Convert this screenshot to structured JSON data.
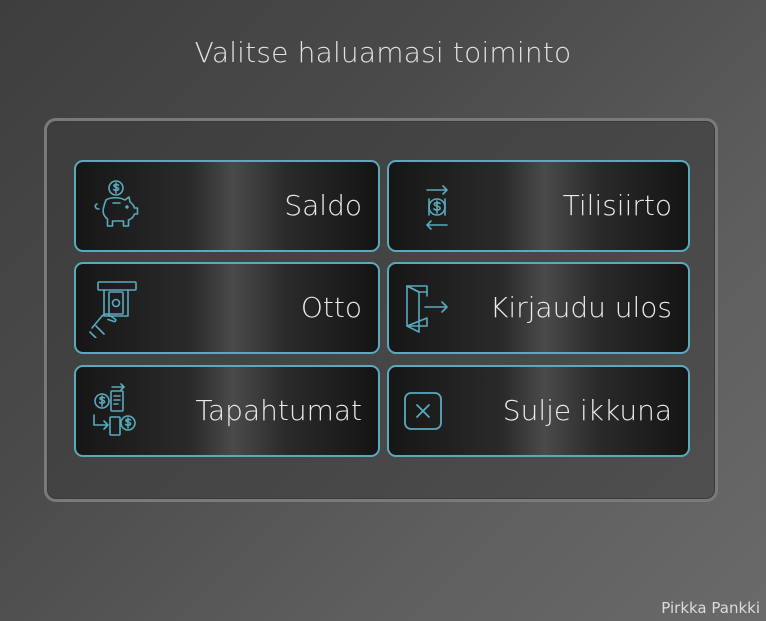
{
  "header": {
    "title": "Valitse haluamasi toiminto"
  },
  "menu": {
    "buttons": [
      {
        "label": "Saldo",
        "icon": "piggy-bank-dollar-icon"
      },
      {
        "label": "Tilisiirto",
        "icon": "transfer-dollar-icon"
      },
      {
        "label": "Otto",
        "icon": "atm-cash-withdraw-icon"
      },
      {
        "label": "Kirjaudu ulos",
        "icon": "logout-door-icon"
      },
      {
        "label": "Tapahtumat",
        "icon": "transactions-exchange-icon"
      },
      {
        "label": "Sulje ikkuna",
        "icon": "close-box-icon"
      }
    ]
  },
  "footer": {
    "brand": "Pirkka Pankki"
  },
  "colors": {
    "accent": "#5aa9bd",
    "background": "#4a4a4a",
    "button_dark": "#161616",
    "text": "#ececec"
  }
}
